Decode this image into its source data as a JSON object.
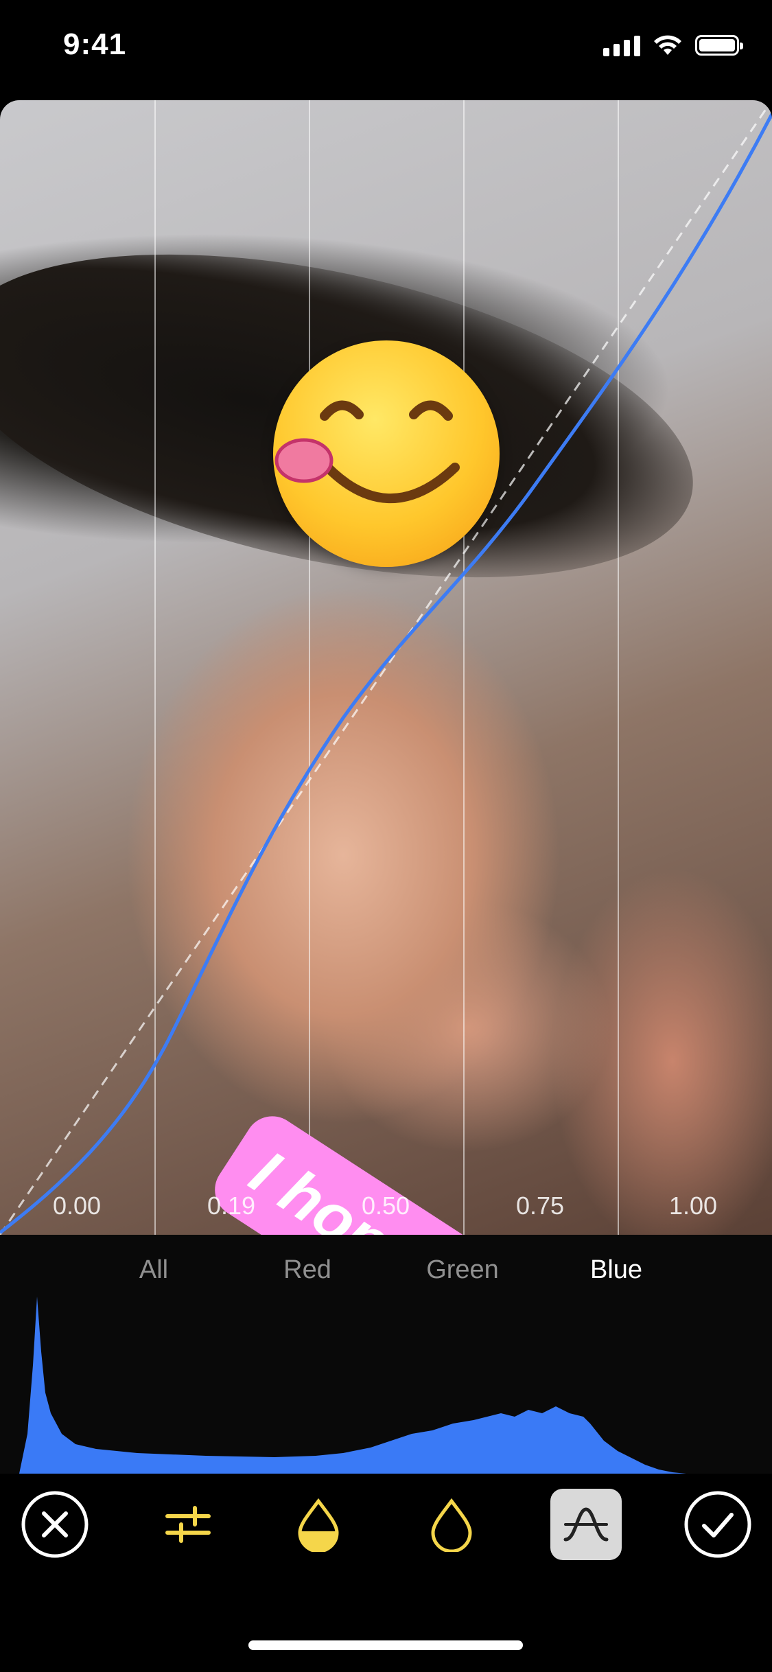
{
  "status_bar": {
    "time": "9:41",
    "icons": [
      "signal-icon",
      "wifi-icon",
      "battery-icon"
    ]
  },
  "curve_editor": {
    "axis_labels": [
      "0.00",
      "0.19",
      "0.50",
      "0.75",
      "1.00"
    ],
    "curve_color": "#3d7cf4",
    "channels": [
      "All",
      "Red",
      "Green",
      "Blue"
    ],
    "selected_channel": "Blue"
  },
  "stickers": {
    "emoji": "savoring-food-emoji",
    "text": "I hope we will, too",
    "text_background": "#ff8df0"
  },
  "toolbar": {
    "items": [
      "close-icon",
      "adjust-sliders-icon",
      "tint-drop-icon",
      "drop-icon",
      "curves-icon",
      "checkmark-icon"
    ],
    "accent_color": "#f5d64a",
    "active_item": "curves-icon"
  }
}
